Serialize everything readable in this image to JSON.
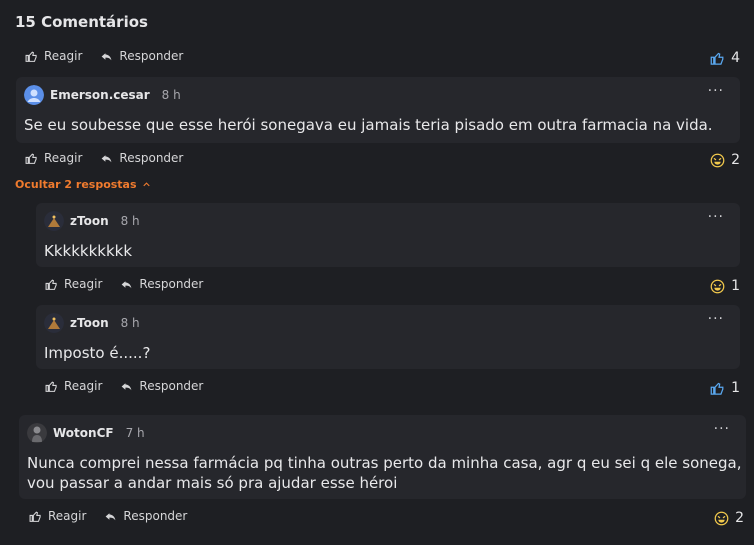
{
  "comments_header": {
    "title": "15 Comentários"
  },
  "actions": {
    "react_label": "Reagir",
    "reply_label": "Responder"
  },
  "colors": {
    "accent": "#f07b2e",
    "like_blue": "#5aa8f0",
    "emoji_yellow": "#f2c94c"
  },
  "post_actions": {
    "reaction_icon": "thumbs-up-icon",
    "reaction_count": "4"
  },
  "comments": [
    {
      "author": "Emerson.cesar",
      "time": "8 h",
      "text": "Se eu soubesse que esse herói sonegava eu jamais teria pisado em outra farmacia na vida.",
      "reaction_icon": "laughing-emoji-icon",
      "reaction_count": "2",
      "replies_toggle": "Ocultar 2 respostas",
      "replies": [
        {
          "author": "zToon",
          "time": "8 h",
          "text": "Kkkkkkkkkk",
          "reaction_icon": "laughing-emoji-icon",
          "reaction_count": "1"
        },
        {
          "author": "zToon",
          "time": "8 h",
          "text": "Imposto é.....?",
          "reaction_icon": "thumbs-up-icon",
          "reaction_count": "1"
        }
      ]
    },
    {
      "author": "WotonCF",
      "time": "7 h",
      "text_line1": "Nunca comprei nessa farmácia pq tinha outras perto da minha casa, agr q eu sei q ele sonega,",
      "text_line2": "vou passar a andar mais só pra ajudar esse héroi",
      "reaction_icon": "laughing-emoji-icon",
      "reaction_count": "2"
    }
  ]
}
